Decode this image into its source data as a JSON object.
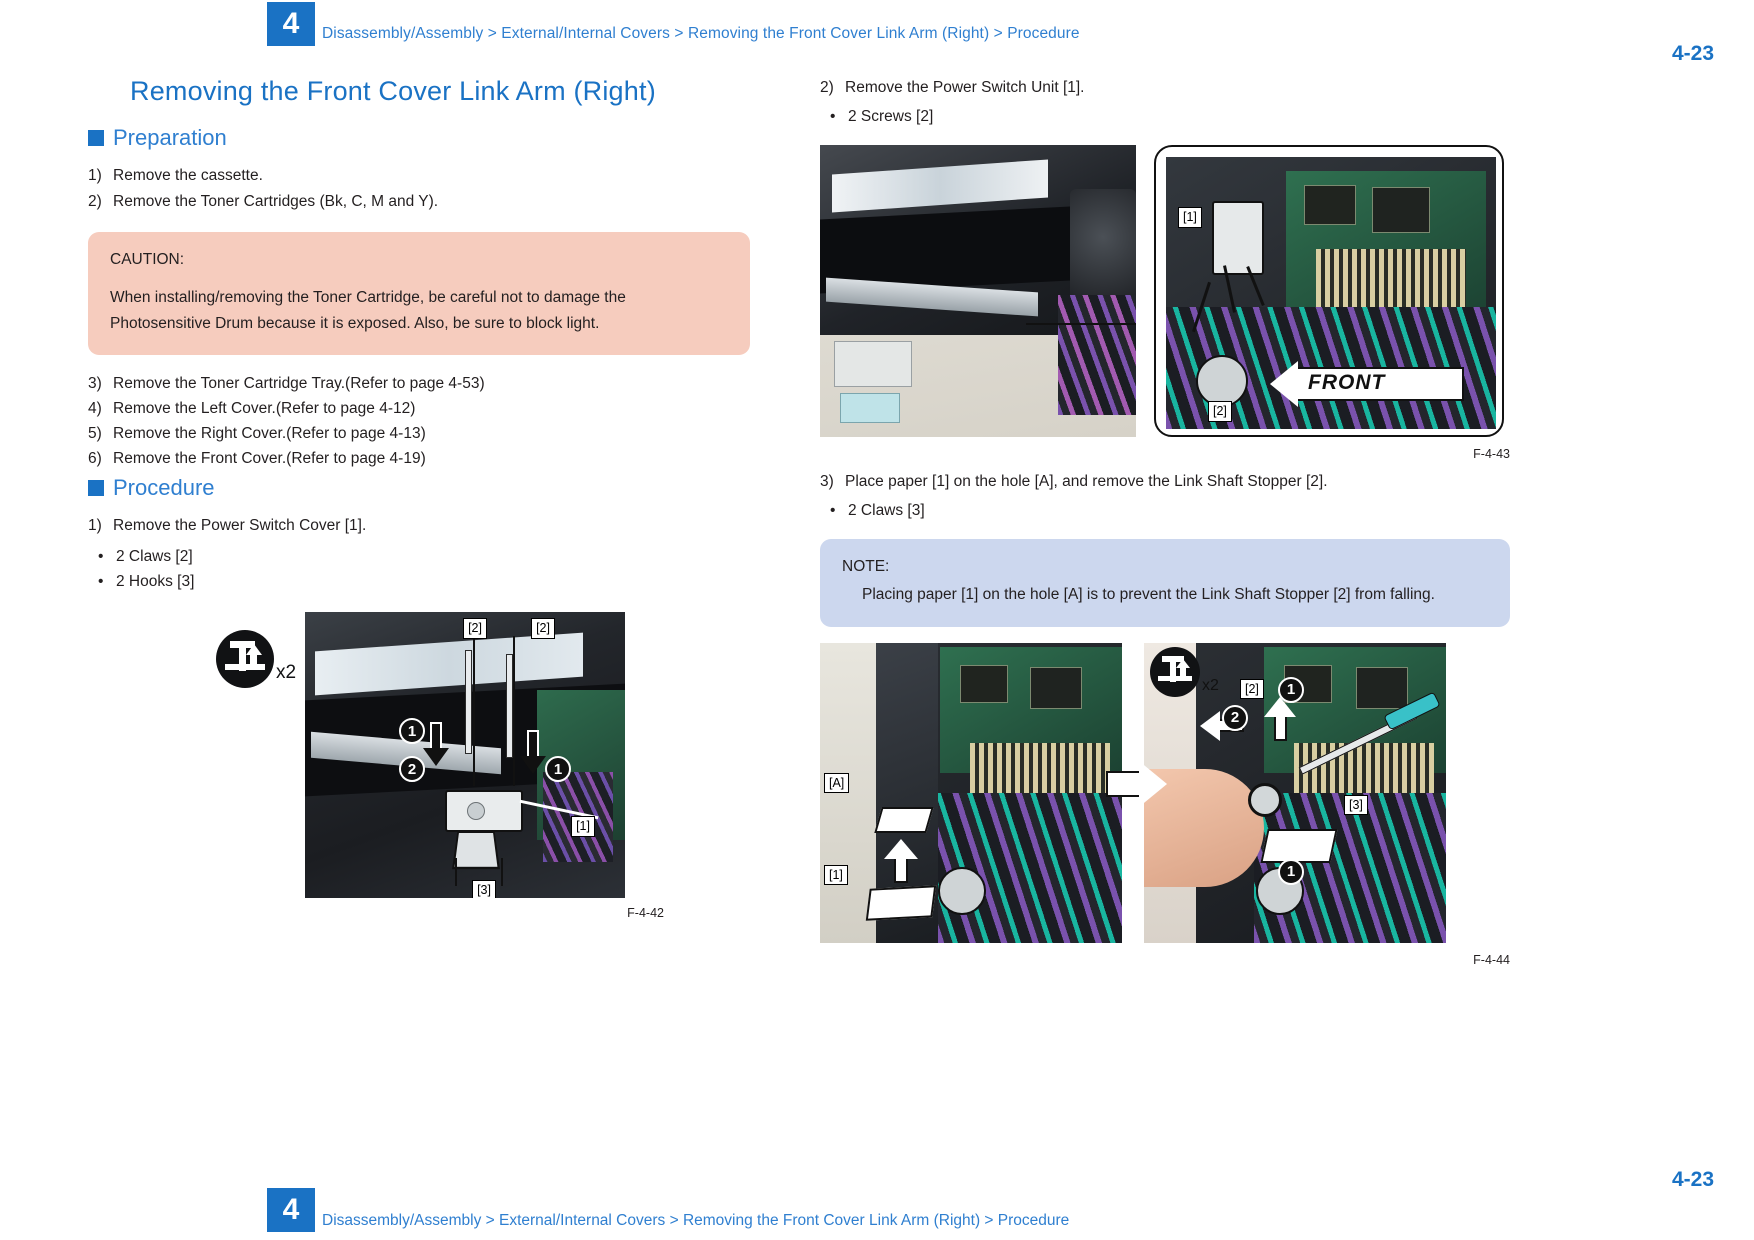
{
  "header": {
    "chapter": "4",
    "breadcrumb": "Disassembly/Assembly > External/Internal Covers > Removing the Front Cover Link Arm (Right) > Procedure",
    "page_number": "4-23"
  },
  "footer": {
    "chapter": "4",
    "breadcrumb": "Disassembly/Assembly > External/Internal Covers > Removing the Front Cover Link Arm (Right) > Procedure",
    "page_number": "4-23"
  },
  "title": "Removing the Front Cover Link Arm (Right)",
  "preparation": {
    "heading": "Preparation",
    "steps": [
      {
        "no": "1)",
        "text": "Remove the cassette."
      },
      {
        "no": "2)",
        "text": "Remove the Toner Cartridges (Bk, C, M and Y)."
      }
    ],
    "caution": {
      "title": "CAUTION:",
      "body": "When installing/removing the Toner Cartridge, be careful not to damage the Photosensitive Drum because it is exposed. Also, be sure to block light."
    },
    "steps2": [
      {
        "no": "3)",
        "text": "Remove the Toner Cartridge Tray.(Refer to page 4-53)"
      },
      {
        "no": "4)",
        "text": "Remove the Left Cover.(Refer to page 4-12)"
      },
      {
        "no": "5)",
        "text": "Remove the Right Cover.(Refer to page 4-13)"
      },
      {
        "no": "6)",
        "text": "Remove the Front Cover.(Refer to page 4-19)"
      }
    ]
  },
  "procedure": {
    "heading": "Procedure",
    "step1": {
      "no": "1)",
      "text": "Remove the Power Switch Cover [1]."
    },
    "step1_bullets": [
      {
        "dot": "•",
        "text": "2 Claws [2]"
      },
      {
        "dot": "•",
        "text": "2 Hooks [3]"
      }
    ],
    "fig1": {
      "caption": "F-4-42",
      "icon_multiplier": "x2",
      "icon_name": "claw-release-icon",
      "tags": [
        "[2]",
        "[2]",
        "[1]",
        "[3]"
      ],
      "callouts": [
        "1",
        "2",
        "1"
      ]
    },
    "step2": {
      "no": "2)",
      "text": "Remove the Power Switch Unit [1]."
    },
    "step2_bullets": [
      {
        "dot": "•",
        "text": "2 Screws [2]"
      }
    ],
    "fig2": {
      "caption": "F-4-43",
      "tags": [
        "[1]",
        "[2]"
      ],
      "front_label": "FRONT"
    },
    "step3": {
      "no": "3)",
      "text": "Place paper [1] on the hole [A], and remove the Link Shaft Stopper [2]."
    },
    "step3_bullets": [
      {
        "dot": "•",
        "text": "2 Claws [3]"
      }
    ],
    "note": {
      "title": "NOTE:",
      "body": "Placing paper [1] on the hole [A] is to prevent the Link Shaft Stopper [2] from falling."
    },
    "fig3": {
      "caption": "F-4-44",
      "icon_multiplier": "x2",
      "icon_name": "claw-release-icon",
      "tags_left": [
        "[A]",
        "[1]"
      ],
      "tags_right": [
        "[2]",
        "[3]"
      ],
      "callouts": [
        "1",
        "2",
        "1"
      ]
    }
  },
  "colors": {
    "accent_blue": "#1a72c4",
    "link_blue": "#2f7fd0",
    "caution_bg": "#f6ccbe",
    "note_bg": "#ccd7ee"
  }
}
